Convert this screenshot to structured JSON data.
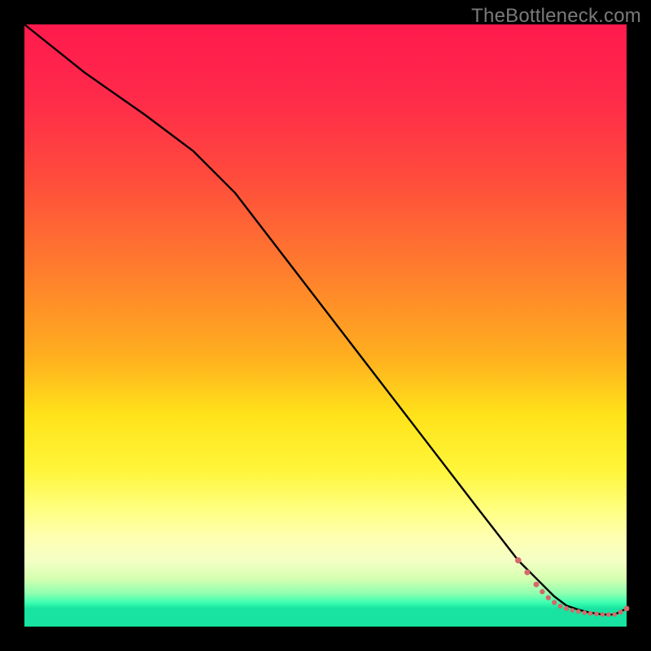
{
  "watermark": "TheBottleneck.com",
  "colors": {
    "dot": "#d46a6a",
    "curve": "#000000",
    "frame": "#000000"
  },
  "chart_data": {
    "type": "line",
    "title": "",
    "xlabel": "",
    "ylabel": "",
    "xlim": [
      0,
      100
    ],
    "ylim": [
      0,
      100
    ],
    "grid": false,
    "legend": false,
    "series": [
      {
        "name": "bottleneck-curve",
        "x": [
          0,
          10,
          20,
          28,
          35,
          45,
          55,
          65,
          75,
          82,
          85,
          88,
          90,
          92,
          94,
          96,
          98,
          100
        ],
        "y": [
          100,
          92,
          85,
          79,
          72,
          59,
          46,
          33,
          20,
          11,
          8,
          5,
          3.5,
          2.8,
          2.3,
          2.0,
          2.0,
          3.0
        ]
      }
    ],
    "scatter": {
      "name": "data-points",
      "points": [
        {
          "x": 82.0,
          "y": 11.0,
          "r": 3.8
        },
        {
          "x": 83.5,
          "y": 9.0,
          "r": 3.5
        },
        {
          "x": 85.0,
          "y": 7.0,
          "r": 3.5
        },
        {
          "x": 86.0,
          "y": 5.8,
          "r": 3.2
        },
        {
          "x": 87.0,
          "y": 4.8,
          "r": 3.2
        },
        {
          "x": 88.0,
          "y": 4.0,
          "r": 3.2
        },
        {
          "x": 89.0,
          "y": 3.4,
          "r": 3.0
        },
        {
          "x": 90.0,
          "y": 3.0,
          "r": 3.0
        },
        {
          "x": 91.0,
          "y": 2.7,
          "r": 2.8
        },
        {
          "x": 92.0,
          "y": 2.5,
          "r": 2.8
        },
        {
          "x": 93.0,
          "y": 2.3,
          "r": 2.8
        },
        {
          "x": 94.0,
          "y": 2.2,
          "r": 2.8
        },
        {
          "x": 95.0,
          "y": 2.1,
          "r": 2.8
        },
        {
          "x": 96.0,
          "y": 2.0,
          "r": 2.8
        },
        {
          "x": 97.0,
          "y": 2.0,
          "r": 2.8
        },
        {
          "x": 98.0,
          "y": 2.0,
          "r": 2.8
        },
        {
          "x": 99.0,
          "y": 2.4,
          "r": 3.0
        },
        {
          "x": 100.0,
          "y": 3.0,
          "r": 3.4
        }
      ]
    }
  }
}
